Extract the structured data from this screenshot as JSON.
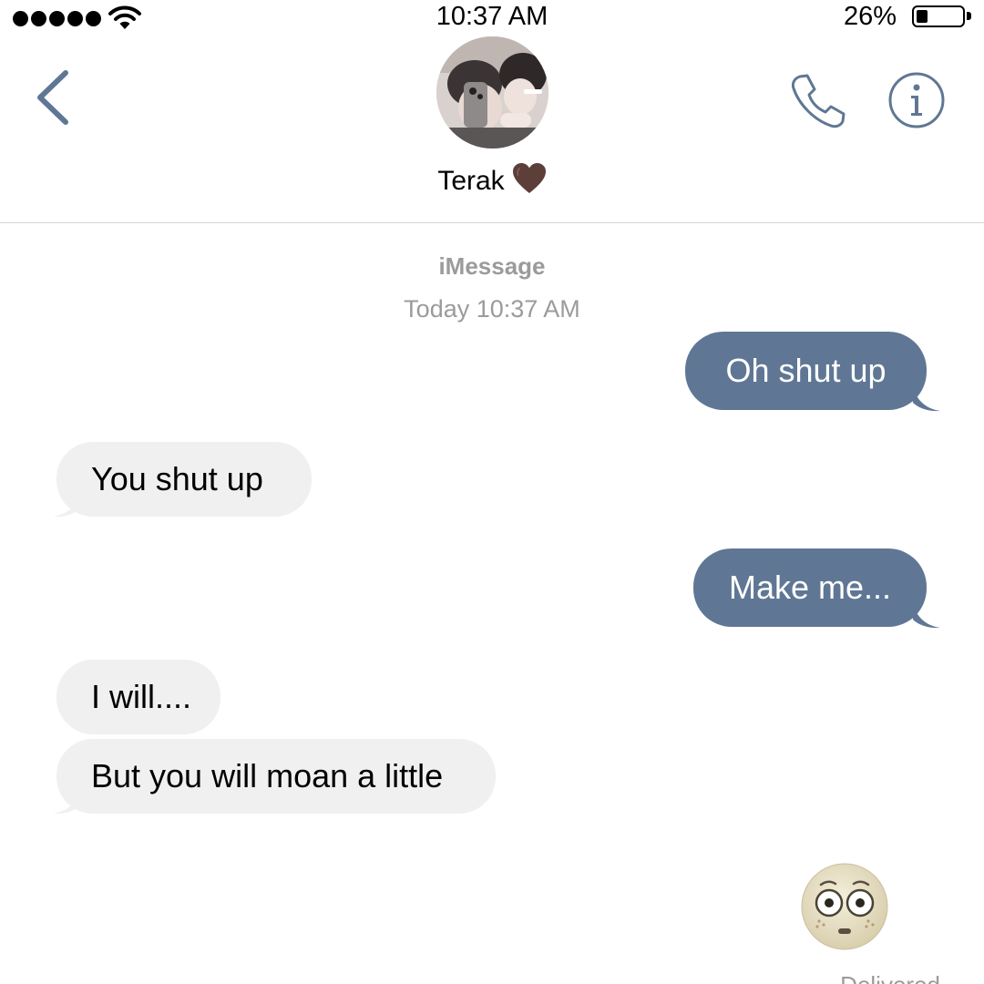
{
  "status_bar": {
    "time": "10:37 AM",
    "battery_percent": "26%",
    "battery_level": 0.26,
    "signal_icon": "signal-dots-icon",
    "wifi_icon": "wifi-icon"
  },
  "header": {
    "contact_name": "Terak",
    "back_icon": "chevron-left-icon",
    "call_icon": "phone-icon",
    "info_icon": "info-icon",
    "heart_icon": "brown-heart-icon",
    "accent_color": "#5f7794"
  },
  "thread": {
    "service": "iMessage",
    "timestamp": "Today 10:37 AM",
    "messages": [
      {
        "direction": "sent",
        "text": "Oh shut up"
      },
      {
        "direction": "received",
        "text": "You shut up"
      },
      {
        "direction": "sent",
        "text": "Make me..."
      },
      {
        "direction": "received",
        "text": "I will...."
      },
      {
        "direction": "received",
        "text": "But you will moan a little"
      },
      {
        "direction": "sent",
        "emoji": "flushed-face-emoji"
      }
    ],
    "status": "Delivered"
  },
  "colors": {
    "sent_bubble": "#5f7794",
    "received_bubble": "#f0f0f1",
    "meta_text": "#9b9b9b"
  }
}
